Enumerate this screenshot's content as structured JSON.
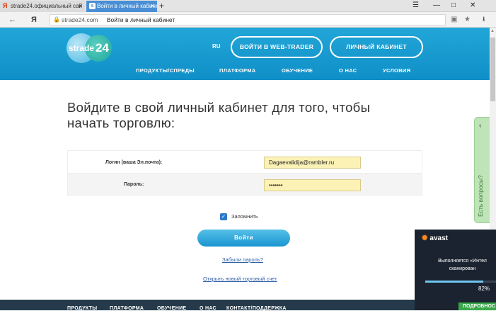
{
  "browser": {
    "tabs": [
      {
        "label": "strade24.официальный сай",
        "active": false,
        "favicon": "yandex-icon"
      },
      {
        "label": "Войти в личный кабинет",
        "active": true,
        "favicon": "strade-icon"
      }
    ],
    "new_tab_glyph": "+",
    "address": {
      "domain": "strade24.com",
      "page_title": "Войти в личный кабинет"
    },
    "yandex_glyph": "Я"
  },
  "site": {
    "logo": {
      "brand": "strade",
      "number": "24"
    },
    "lang": "RU",
    "buttons": {
      "web_trader": "ВОЙТИ В WEB-TRADER",
      "cabinet": "ЛИЧНЫЙ КАБИНЕТ"
    },
    "nav": [
      "ПРОДУКТЫ/СПРЕДЫ",
      "ПЛАТФОРМА",
      "ОБУЧЕНИЕ",
      "О НАС",
      "УСЛОВИЯ"
    ],
    "accent": "#1a9fd6"
  },
  "main": {
    "heading": "Войдите в свой личный кабинет для того, чтобы начать торговлю:",
    "login_label": "Логин (ваша Эл.почта):",
    "login_value": "Dagaevalidija@rambler.ru",
    "password_label": "Пароль:",
    "password_value": "•••••••",
    "remember_label": "Запомнить",
    "remember_checked": true,
    "login_button": "Войти",
    "forgot_link": "Забыли пароль?",
    "open_account_link": "Открыть новый торговый счет"
  },
  "side_tab": {
    "label": "Есть вопросы?"
  },
  "footer": {
    "items": [
      "ПРОДУКТЫ",
      "ПЛАТФОРМА",
      "ОБУЧЕНИЕ",
      "О НАС",
      "КОНТАКТ/ПОДДЕРЖКА"
    ]
  },
  "avast": {
    "brand": "avast",
    "message_line1": "Выполняется «Интел",
    "message_line2": "сканирован",
    "progress_percent": 82,
    "progress_label": "82%",
    "details_button": "ПОДРОБНОС"
  }
}
